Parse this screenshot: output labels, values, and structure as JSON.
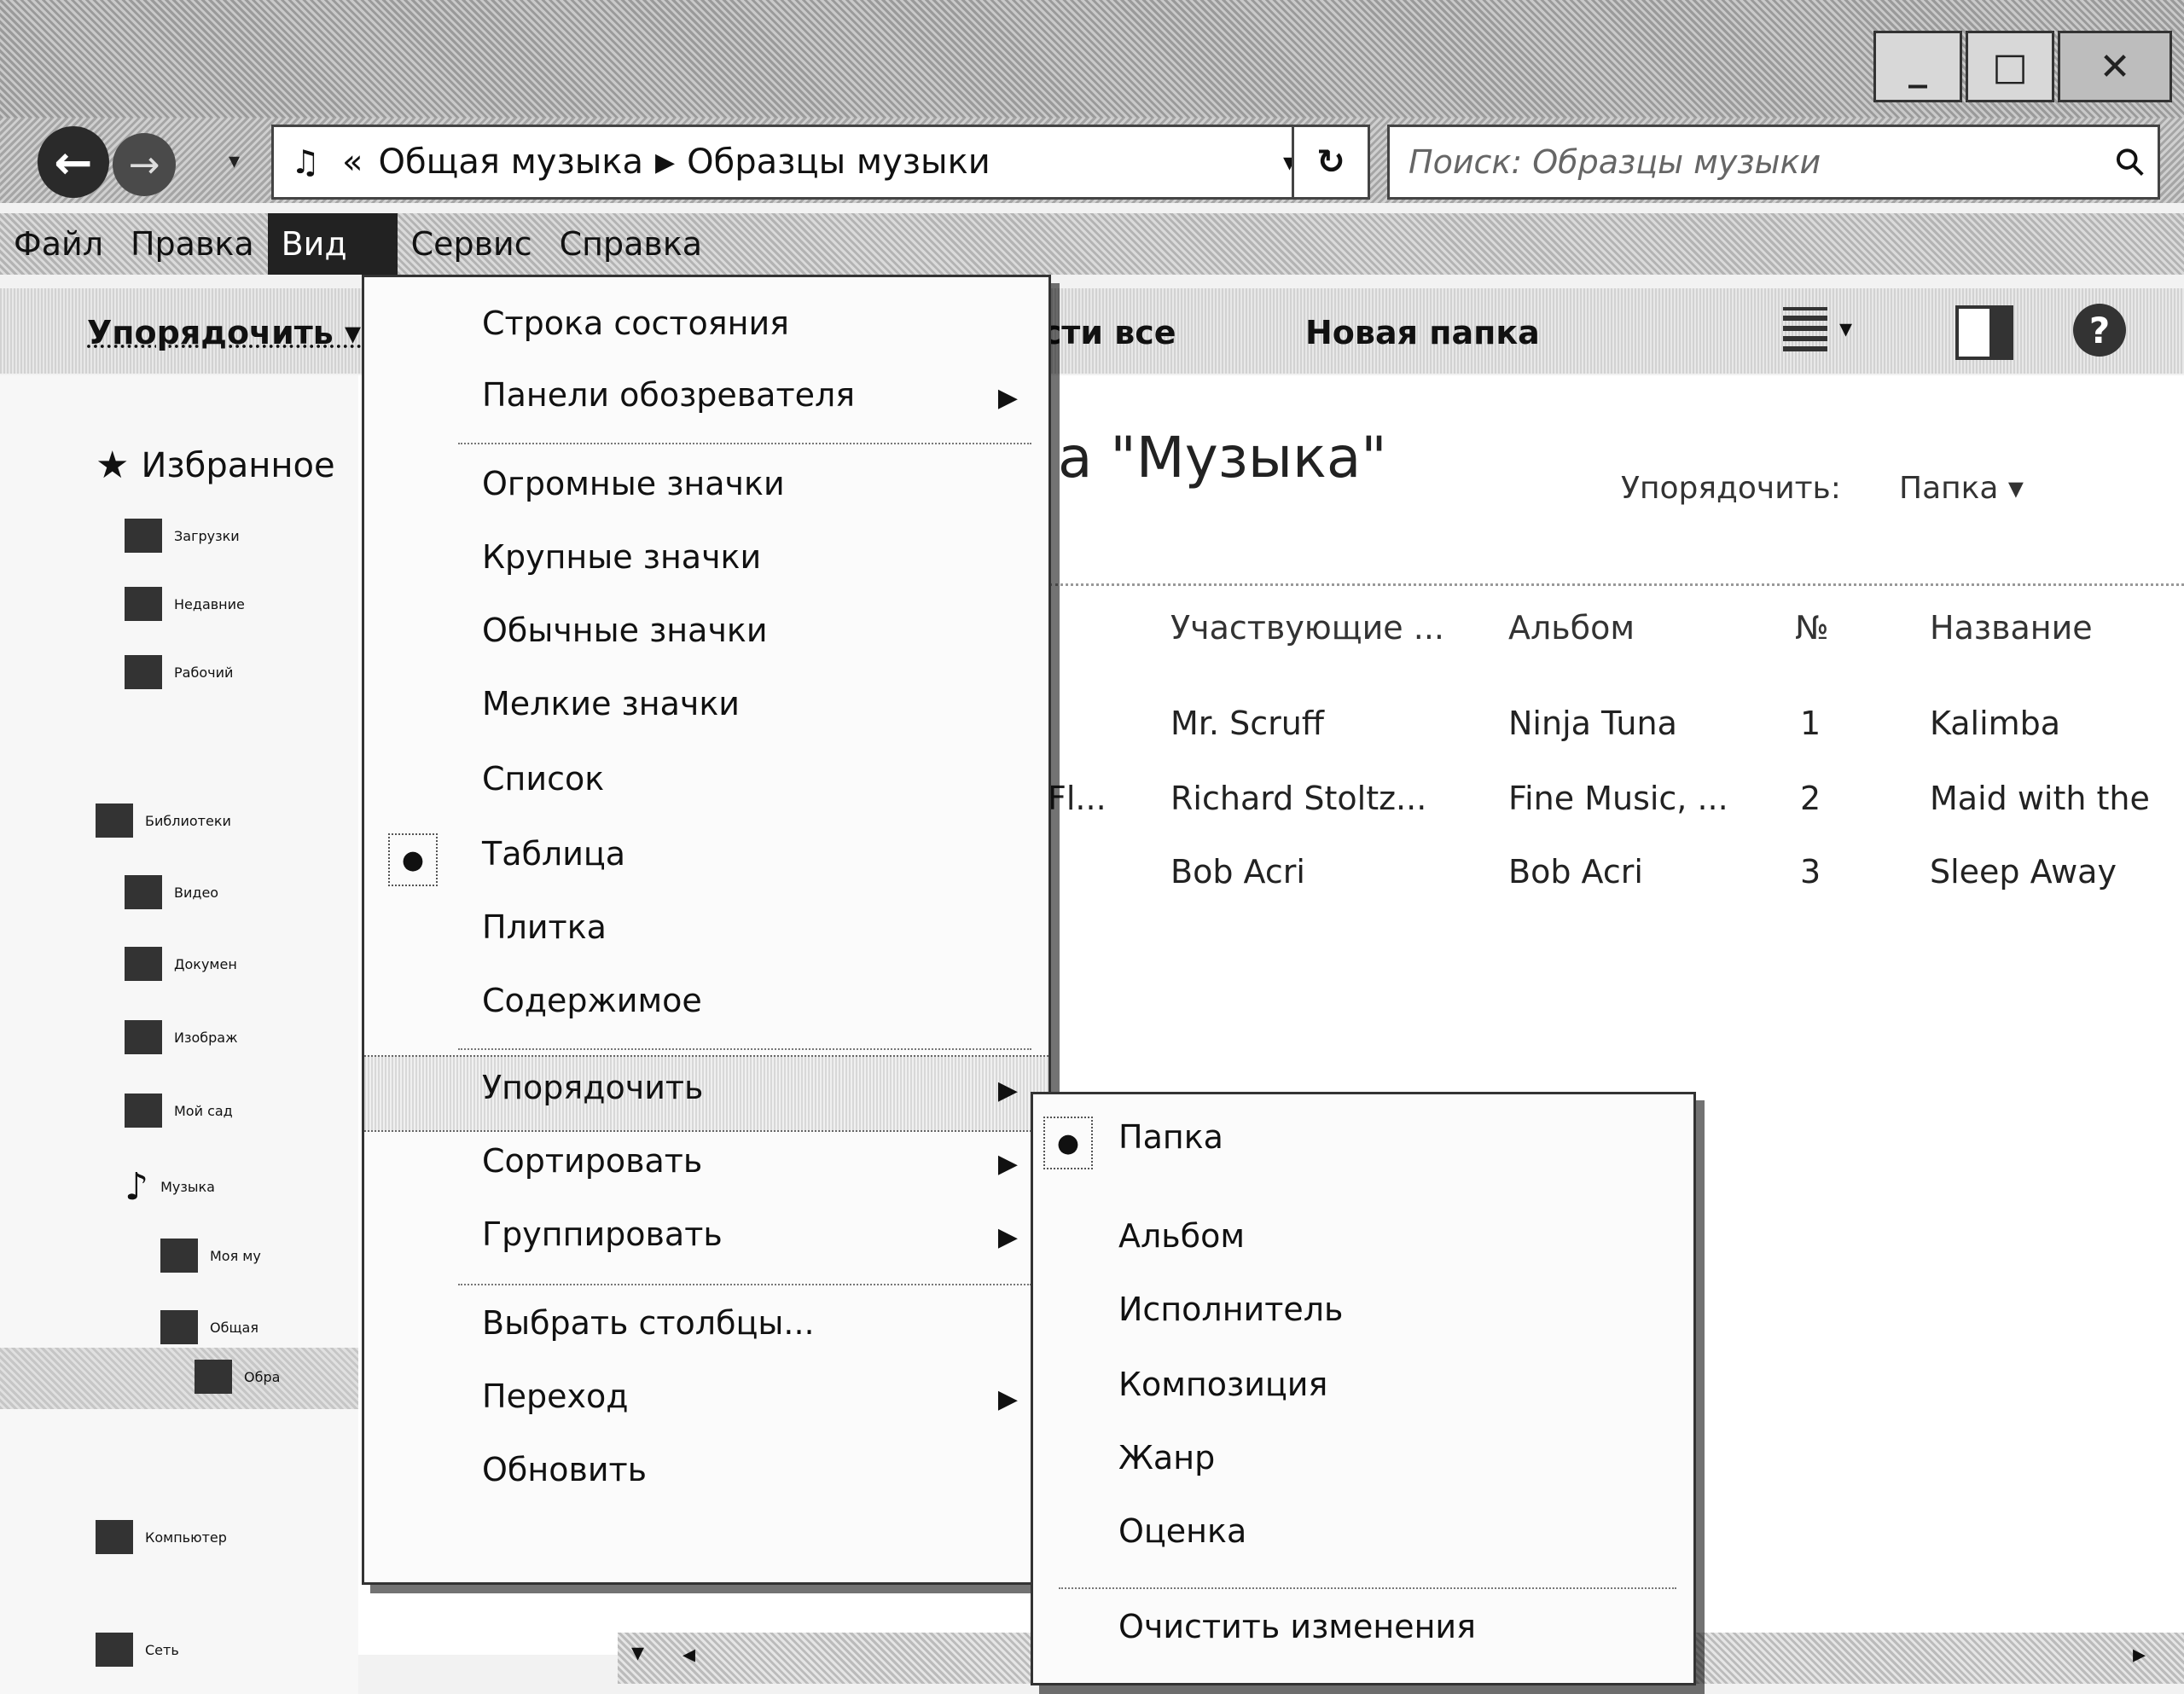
{
  "window": {
    "title": "",
    "caption": {
      "minimize": "_",
      "maximize": "□",
      "close": "✕"
    }
  },
  "address_bar": {
    "prefix": "«",
    "crumbs": [
      "Общая музыка",
      "Образцы музыки"
    ],
    "search_placeholder": "Поиск: Образцы музыки"
  },
  "menubar": {
    "items": [
      "Файл",
      "Правка",
      "Вид",
      "Сервис",
      "Справка"
    ],
    "active_index": 2
  },
  "toolbar": {
    "organize": "Упорядочить ▾",
    "play_all": "ести все",
    "new_folder": "Новая папка"
  },
  "nav": {
    "favorites_header": "Избранное",
    "favorites": [
      "Загрузки",
      "Недавние",
      "Рабочий"
    ],
    "libraries_header": "Библиотеки",
    "libraries": [
      "Видео",
      "Докумен",
      "Изображ",
      "Мой сад",
      "Музыка"
    ],
    "music_children": [
      "Моя му",
      "Общая",
      "Обра"
    ],
    "computer": "Компьютер",
    "network": "Сеть"
  },
  "content": {
    "library_title": "а \"Музыка\"",
    "arrange_label": "Упорядочить:",
    "arrange_value": "Папка ▾",
    "columns": [
      "Участвующие ...",
      "Альбом",
      "№",
      "Название"
    ],
    "partial_first_cell": "Fl...",
    "rows": [
      {
        "artist": "Mr. Scruff",
        "album": "Ninja Tuna",
        "num": "1",
        "title": "Kalimba"
      },
      {
        "artist": "Richard Stoltz...",
        "album": "Fine Music, ...",
        "num": "2",
        "title": "Maid with the"
      },
      {
        "artist": "Bob Acri",
        "album": "Bob Acri",
        "num": "3",
        "title": "Sleep Away"
      }
    ]
  },
  "view_menu": {
    "items": [
      {
        "label": "Строка состояния",
        "submenu": false
      },
      {
        "label": "Панели обозревателя",
        "submenu": true
      },
      {
        "label": "Огромные значки",
        "submenu": false
      },
      {
        "label": "Крупные значки",
        "submenu": false
      },
      {
        "label": "Обычные значки",
        "submenu": false
      },
      {
        "label": "Мелкие значки",
        "submenu": false
      },
      {
        "label": "Список",
        "submenu": false
      },
      {
        "label": "Таблица",
        "submenu": false,
        "selected": true
      },
      {
        "label": "Плитка",
        "submenu": false
      },
      {
        "label": "Содержимое",
        "submenu": false
      },
      {
        "label": "Упорядочить",
        "submenu": true,
        "highlighted": true
      },
      {
        "label": "Сортировать",
        "submenu": true
      },
      {
        "label": "Группировать",
        "submenu": true
      },
      {
        "label": "Выбрать столбцы...",
        "submenu": false
      },
      {
        "label": "Переход",
        "submenu": true
      },
      {
        "label": "Обновить",
        "submenu": false
      }
    ]
  },
  "arrange_submenu": {
    "items": [
      "Папка",
      "Альбом",
      "Исполнитель",
      "Композиция",
      "Жанр",
      "Оценка",
      "Очистить изменения"
    ],
    "selected_index": 0
  }
}
